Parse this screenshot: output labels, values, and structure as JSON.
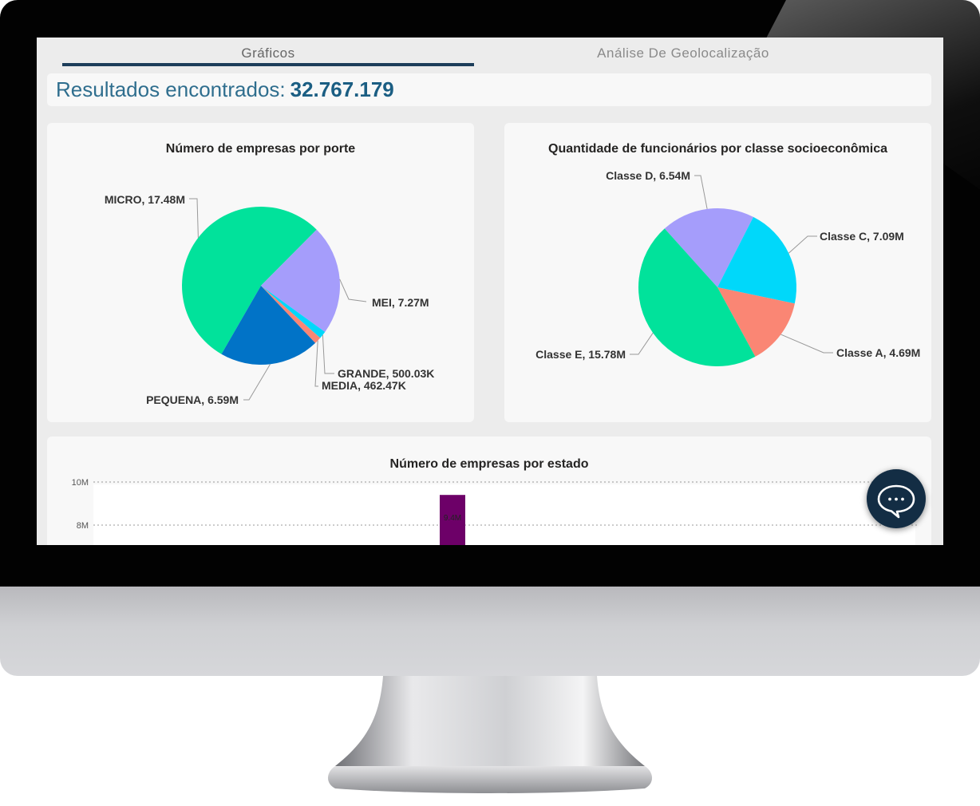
{
  "tabs": [
    {
      "label": "Gráficos",
      "active": true
    },
    {
      "label": "Análise De Geolocalização",
      "active": false
    }
  ],
  "results": {
    "label": "Resultados encontrados:",
    "value": "32.767.179"
  },
  "chart_data": [
    {
      "type": "pie",
      "title": "Número de empresas por porte",
      "slices": [
        {
          "name": "MICRO",
          "value": 17.48,
          "label": "MICRO, 17.48M",
          "color": "#01e29b"
        },
        {
          "name": "MEI",
          "value": 7.27,
          "label": "MEI, 7.27M",
          "color": "#a59dfb"
        },
        {
          "name": "GRANDE",
          "value": 0.50003,
          "label": "GRANDE, 500.03K",
          "color": "#00d8fa"
        },
        {
          "name": "MEDIA",
          "value": 0.46247,
          "label": "MEDIA, 462.47K",
          "color": "#fa8674"
        },
        {
          "name": "PEQUENA",
          "value": 6.59,
          "label": "PEQUENA, 6.59M",
          "color": "#0173c7"
        }
      ]
    },
    {
      "type": "pie",
      "title": "Quantidade de funcionários por classe socioeconômica",
      "slices": [
        {
          "name": "Classe D",
          "value": 6.54,
          "label": "Classe D, 6.54M",
          "color": "#a59dfb"
        },
        {
          "name": "Classe C",
          "value": 7.09,
          "label": "Classe C, 7.09M",
          "color": "#00d8fa"
        },
        {
          "name": "Classe A",
          "value": 4.69,
          "label": "Classe A, 4.69M",
          "color": "#fa8674"
        },
        {
          "name": "Classe E",
          "value": 15.78,
          "label": "Classe E, 15.78M",
          "color": "#01e29b"
        }
      ]
    },
    {
      "type": "bar",
      "title": "Número de empresas por estado",
      "y_ticks": [
        "10M",
        "8M"
      ],
      "ylim": [
        0,
        10
      ],
      "bars": [
        {
          "value": 9.4,
          "label": "9.4M",
          "color": "#6d0068"
        }
      ],
      "grid": true
    }
  ]
}
